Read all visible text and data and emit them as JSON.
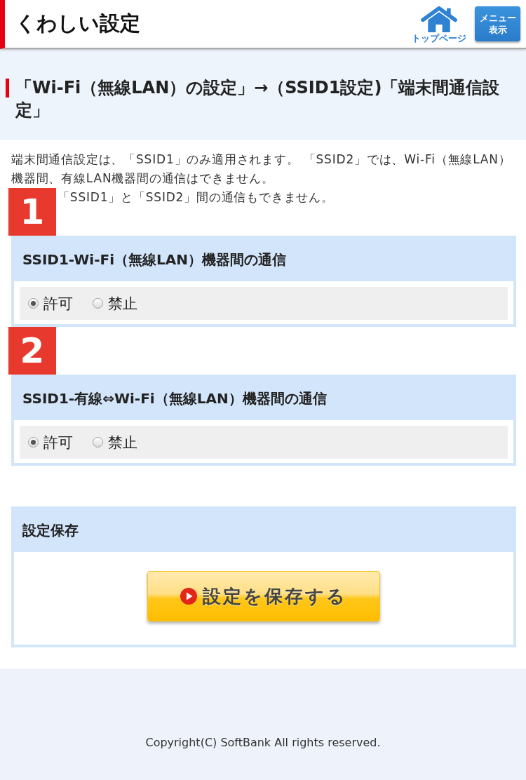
{
  "header": {
    "title": "くわしい設定",
    "home_link": {
      "label": "トップページ"
    },
    "menu_button": {
      "label": "メニュー表示"
    }
  },
  "page_heading": "「Wi-Fi（無線LAN）の設定」→（SSID1設定)「端末間通信設定」",
  "intro": {
    "text": "端末間通信設定は、「SSID1」のみ適用されます。 「SSID2」では、Wi-Fi（無線LAN）機器間、有線LAN機器間の通信はできません。",
    "note": "「SSID1」と「SSID2」間の通信もできません。"
  },
  "sections": [
    {
      "number": "1",
      "title": "SSID1-Wi-Fi（無線LAN）機器間の通信",
      "options": [
        {
          "label": "許可",
          "selected": true
        },
        {
          "label": "禁止",
          "selected": false
        }
      ]
    },
    {
      "number": "2",
      "title": "SSID1-有線⇔Wi-Fi（無線LAN）機器間の通信",
      "options": [
        {
          "label": "許可",
          "selected": true
        },
        {
          "label": "禁止",
          "selected": false
        }
      ]
    }
  ],
  "save_section": {
    "title": "設定保存",
    "button": "設定を保存する"
  },
  "footer": {
    "copyright": "Copyright(C) SoftBank All rights reserved."
  }
}
